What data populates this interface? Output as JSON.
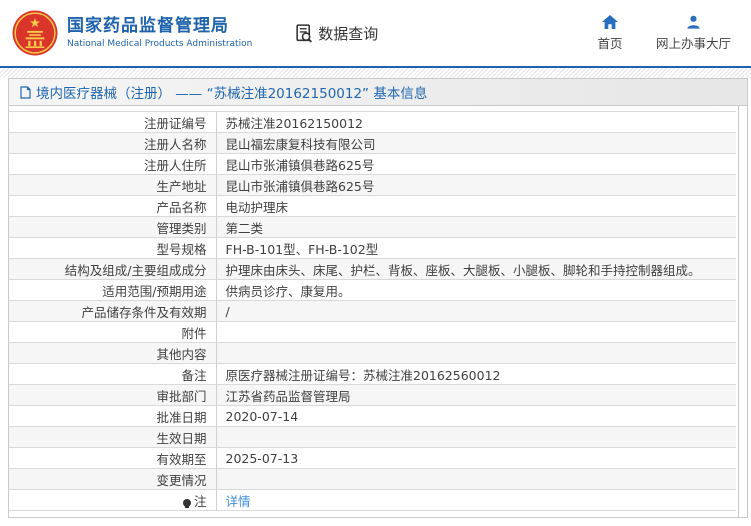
{
  "header": {
    "brand": {
      "title": "国家药品监督管理局",
      "subtitle": "National Medical Products Administration"
    },
    "data_query_label": "数据查询",
    "nav": [
      {
        "label": "首页",
        "icon": "home-icon"
      },
      {
        "label": "网上办事大厅",
        "icon": "person-icon"
      }
    ]
  },
  "title_bar": {
    "text": "境内医疗器械（注册） —— “苏械注准20162150012” 基本信息"
  },
  "table": {
    "rows": [
      {
        "label": "注册证编号",
        "value": "苏械注准20162150012"
      },
      {
        "label": "注册人名称",
        "value": "昆山福宏康复科技有限公司"
      },
      {
        "label": "注册人住所",
        "value": "昆山市张浦镇俱巷路625号"
      },
      {
        "label": "生产地址",
        "value": "昆山市张浦镇俱巷路625号"
      },
      {
        "label": "产品名称",
        "value": "电动护理床"
      },
      {
        "label": "管理类别",
        "value": "第二类"
      },
      {
        "label": "型号规格",
        "value": "FH-B-101型、FH-B-102型"
      },
      {
        "label": "结构及组成/主要组成成分",
        "value": "护理床由床头、床尾、护栏、背板、座板、大腿板、小腿板、脚轮和手持控制器组成。"
      },
      {
        "label": "适用范围/预期用途",
        "value": "供病员诊疗、康复用。"
      },
      {
        "label": "产品储存条件及有效期",
        "value": "/"
      },
      {
        "label": "附件",
        "value": ""
      },
      {
        "label": "其他内容",
        "value": ""
      },
      {
        "label": "备注",
        "value": "原医疗器械注册证编号：苏械注准20162560012"
      },
      {
        "label": "审批部门",
        "value": "江苏省药品监督管理局"
      },
      {
        "label": "批准日期",
        "value": "2020-07-14"
      },
      {
        "label": "生效日期",
        "value": ""
      },
      {
        "label": "有效期至",
        "value": "2025-07-13"
      },
      {
        "label": "变更情况",
        "value": ""
      },
      {
        "label": "注",
        "value": "详情",
        "label_icon": "note-icon",
        "value_is_link": true
      }
    ]
  },
  "colors": {
    "brand_blue": "#1f63ac",
    "nav_icon_blue": "#2a6fbd",
    "link_blue": "#3e8ede",
    "emblem_red": "#d9352b",
    "title_text_blue": "#2166ae"
  }
}
